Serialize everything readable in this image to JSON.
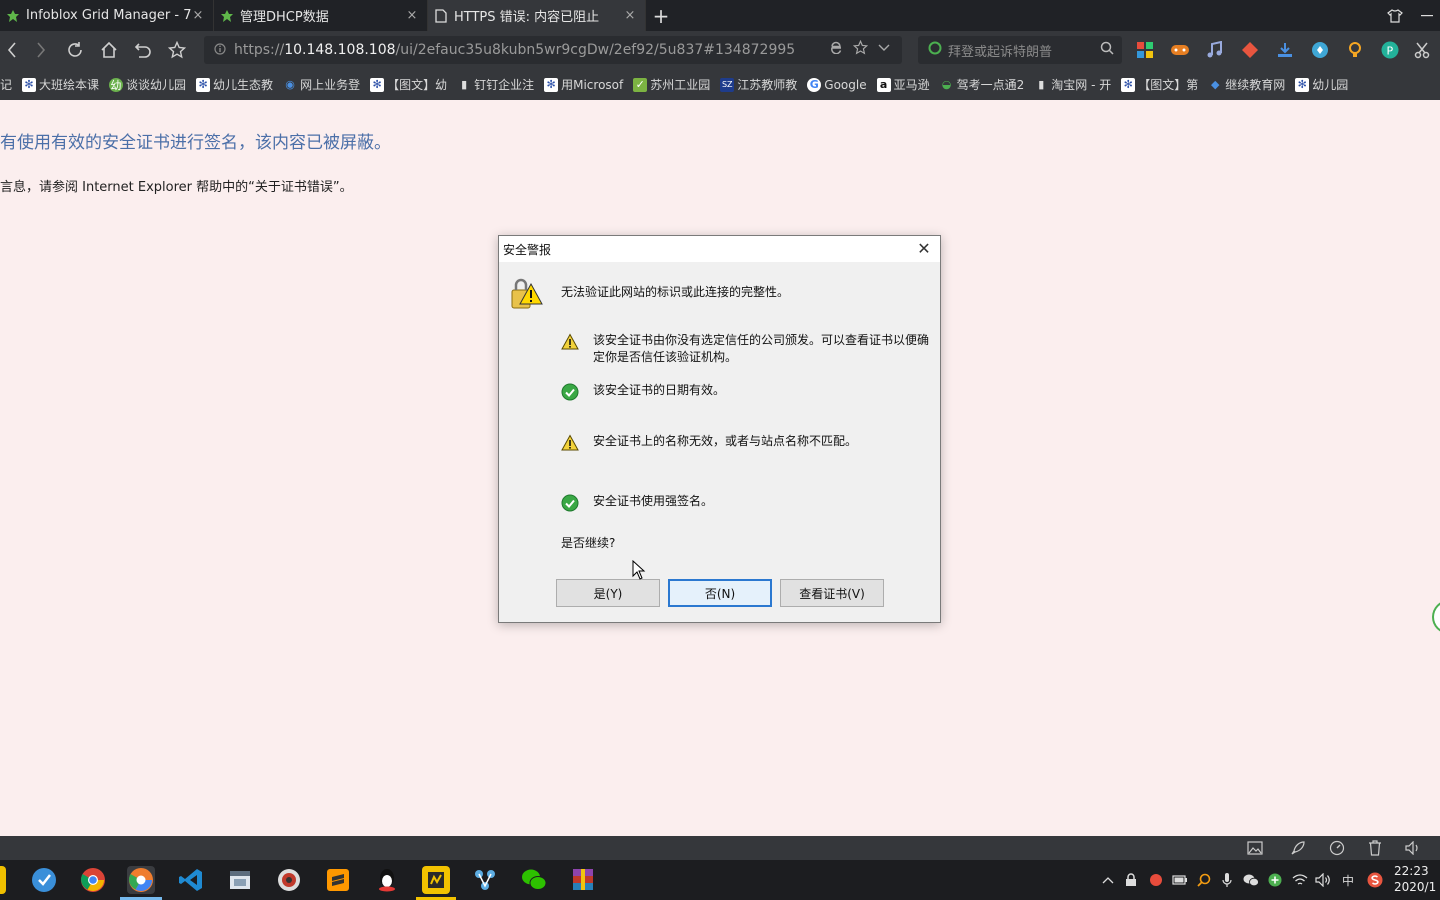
{
  "browser": {
    "tabs": [
      {
        "label": "Infoblox Grid Manager - 7.",
        "close": "×"
      },
      {
        "label": "管理DHCP数据",
        "close": "×"
      },
      {
        "label": "HTTPS 错误: 内容已阻止",
        "close": "×"
      }
    ],
    "new_tab": "+",
    "url": {
      "prefix": "https://",
      "host": "10.148.108.108",
      "path": "/ui/2efauc35u8kubn5wr9cgDw/2ef92/5u837#134872995"
    },
    "search_placeholder": "拜登或起诉特朗普",
    "bookmarks": [
      "记",
      "大班绘本课",
      "谈谈幼儿园",
      "幼儿生态教",
      "网上业务登",
      "【图文】幼",
      "钉钉企业注",
      "用Microsof",
      "苏州工业园",
      "江苏教师教",
      "Google",
      "亚马逊",
      "驾考一点通2",
      "淘宝网 - 开",
      "【图文】第",
      "继续教育网",
      "幼儿园"
    ]
  },
  "page": {
    "line1": "有使用有效的安全证书进行签名，该内容已被屏蔽。",
    "line2": "言息，请参阅 Internet Explorer 帮助中的“关于证书错误”。"
  },
  "dialog": {
    "title": "安全警报",
    "close": "✕",
    "heading": "无法验证此网站的标识或此连接的完整性。",
    "items": [
      {
        "status": "warning",
        "text": "该安全证书由你没有选定信任的公司颁发。可以查看证书以便确定你是否信任该验证机构。"
      },
      {
        "status": "ok",
        "text": "该安全证书的日期有效。"
      },
      {
        "status": "warning",
        "text": "安全证书上的名称无效，或者与站点名称不匹配。"
      },
      {
        "status": "ok",
        "text": "安全证书使用强签名。"
      }
    ],
    "question": "是否继续?",
    "buttons": {
      "yes": "是(Y)",
      "no": "否(N)",
      "view_cert": "查看证书(V)"
    }
  },
  "taskbar": {
    "clock_time": "22:23",
    "clock_date": "2020/1",
    "ime": "中"
  },
  "colors": {
    "accent": "#2b78d0",
    "page_bg": "#fbeeee",
    "link_blue": "#4b6fa8",
    "warning": "#e8c400",
    "ok": "#3aa845"
  }
}
